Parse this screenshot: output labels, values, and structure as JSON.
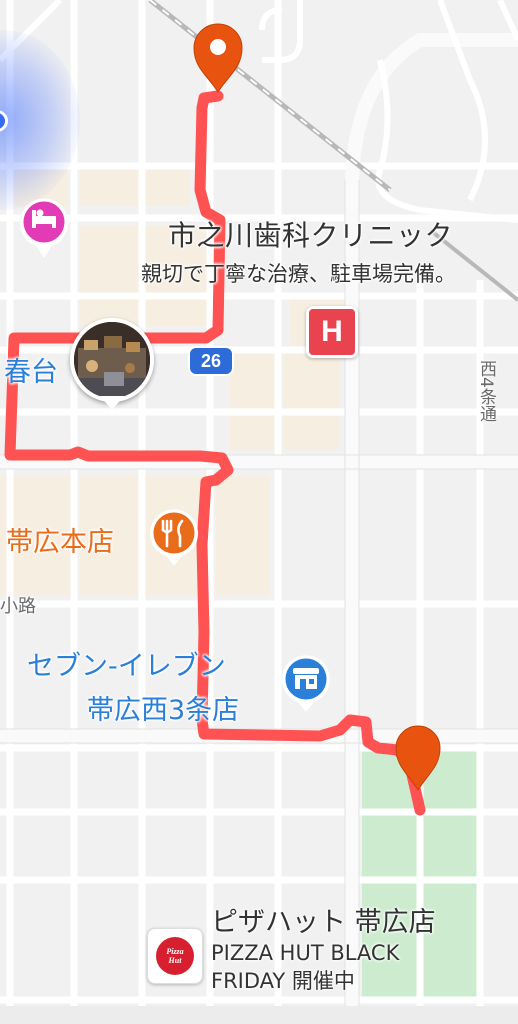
{
  "colors": {
    "route": "#ff5252",
    "pin": "#e8530f",
    "hospital": "#e8434e",
    "lodging": "#e33ab5",
    "restaurant": "#e86c19",
    "store": "#2a7fd9",
    "park": "#cdeccf",
    "road_shield": "#2d6bd9"
  },
  "pois": {
    "clinic": {
      "name": "市之川歯科クリニック",
      "tagline": "親切で丁寧な治療、駐車場完備。"
    },
    "hospital": {
      "glyph": "H",
      "icon": "hospital-icon"
    },
    "road_shield": {
      "number": "26"
    },
    "district_label": "春台",
    "restaurant": {
      "name": "帯広本店",
      "icon": "fork-knife-icon"
    },
    "alley_label": "小路",
    "street_label": "西4条通",
    "convenience_store": {
      "line1": "セブン-イレブン",
      "line2": "帯広西3条店",
      "icon": "store-icon"
    },
    "pizza_hut": {
      "name": "ピザハット 帯広店",
      "promo": "PIZZA HUT BLACK FRIDAY 開催中",
      "logo_text_1": "Pizza",
      "logo_text_2": "Hut"
    },
    "lodging": {
      "icon": "bed-icon"
    },
    "photo_poi": {
      "icon": "photo-thumbnail"
    }
  },
  "markers": {
    "start": {
      "icon": "location-pin-icon"
    },
    "end": {
      "icon": "location-pin-icon"
    }
  }
}
